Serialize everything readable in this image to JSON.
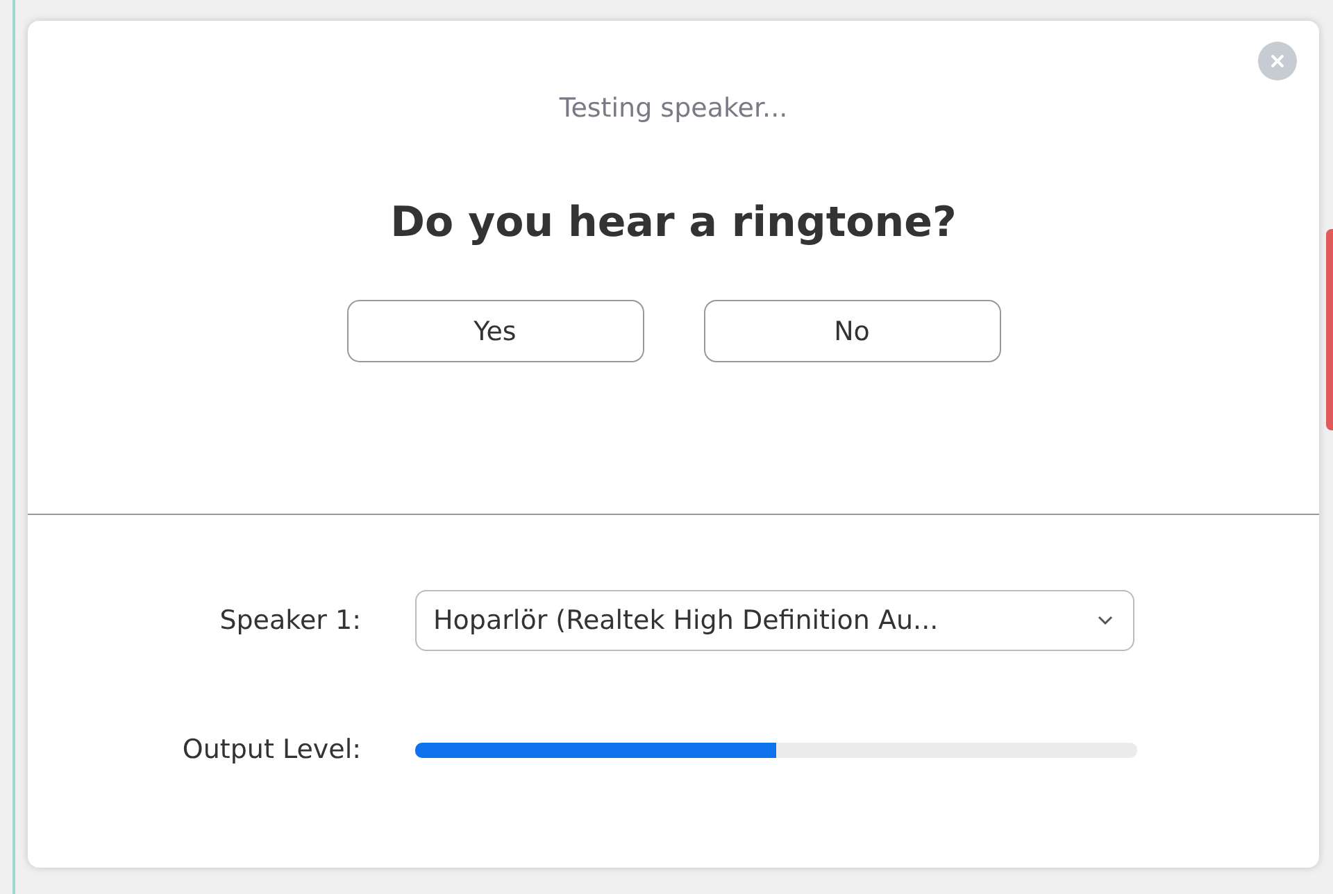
{
  "dialog": {
    "status": "Testing speaker...",
    "question": "Do you hear a ringtone?",
    "buttons": [
      "Yes",
      "No"
    ],
    "speaker": {
      "label": "Speaker 1:",
      "value": "Hoparlör (Realtek High Definition Au..."
    },
    "output": {
      "label": "Output Level:",
      "level": 0.5
    }
  }
}
